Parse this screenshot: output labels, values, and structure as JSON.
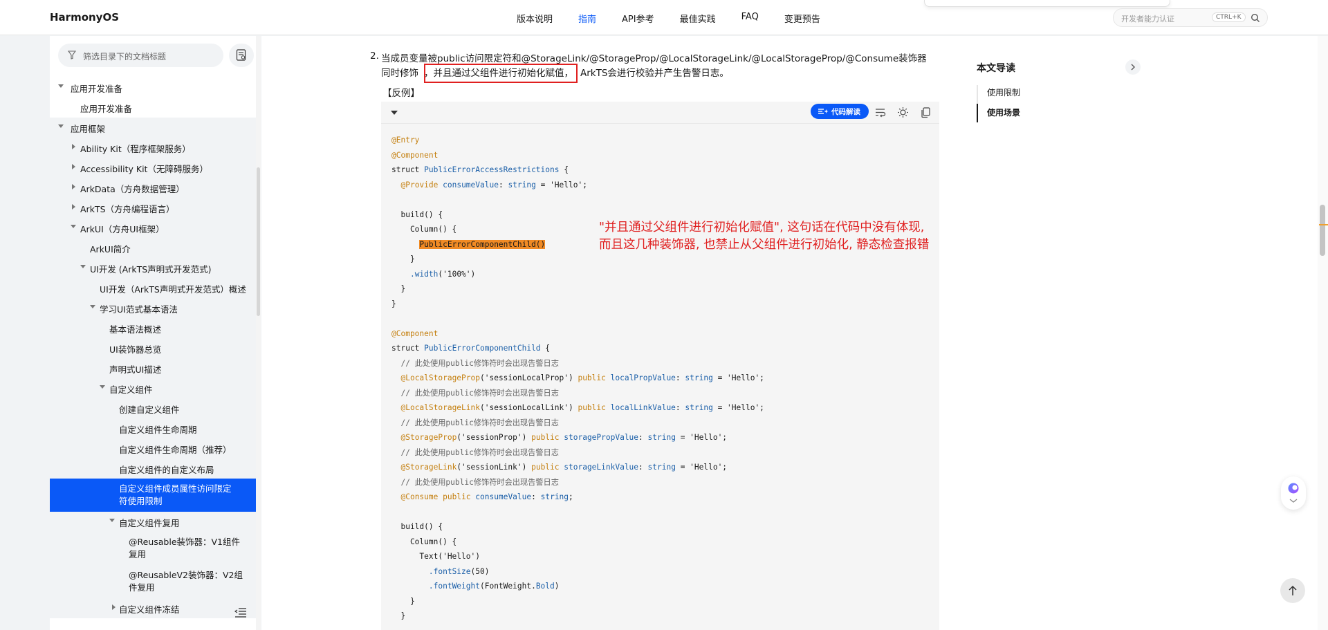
{
  "header": {
    "logo": "HarmonyOS",
    "nav": [
      "版本说明",
      "指南",
      "API参考",
      "最佳实践",
      "FAQ",
      "变更预告"
    ],
    "search_placeholder": "开发者能力认证",
    "search_shortcut": "CTRL+K"
  },
  "sidebar": {
    "filter_placeholder": "筛选目录下的文档标题",
    "items": [
      {
        "label": "应用开发准备",
        "arrow": "down"
      },
      {
        "label": "应用开发准备",
        "arrow": ""
      },
      {
        "label": "应用框架",
        "arrow": "down"
      },
      {
        "label": "Ability Kit（程序框架服务）",
        "arrow": "right"
      },
      {
        "label": "Accessibility Kit（无障碍服务）",
        "arrow": "right"
      },
      {
        "label": "ArkData（方舟数据管理）",
        "arrow": "right"
      },
      {
        "label": "ArkTS（方舟编程语言）",
        "arrow": "right"
      },
      {
        "label": "ArkUI（方舟UI框架）",
        "arrow": "down"
      },
      {
        "label": "ArkUI简介",
        "arrow": ""
      },
      {
        "label": "UI开发 (ArkTS声明式开发范式)",
        "arrow": "down"
      },
      {
        "label": "UI开发（ArkTS声明式开发范式）概述",
        "arrow": ""
      },
      {
        "label": "学习UI范式基本语法",
        "arrow": "down"
      },
      {
        "label": "基本语法概述",
        "arrow": ""
      },
      {
        "label": "UI装饰器总览",
        "arrow": ""
      },
      {
        "label": "声明式UI描述",
        "arrow": ""
      },
      {
        "label": "自定义组件",
        "arrow": "down"
      },
      {
        "label": "创建自定义组件",
        "arrow": ""
      },
      {
        "label": "自定义组件生命周期",
        "arrow": ""
      },
      {
        "label": "自定义组件生命周期（推荐）",
        "arrow": ""
      },
      {
        "label": "自定义组件的自定义布局",
        "arrow": ""
      },
      {
        "label": "自定义组件成员属性访问限定符使用限制",
        "arrow": ""
      },
      {
        "label": "自定义组件复用",
        "arrow": "down"
      },
      {
        "label": "@Reusable装饰器：V1组件复用",
        "arrow": ""
      },
      {
        "label": "@ReusableV2装饰器：V2组件复用",
        "arrow": ""
      },
      {
        "label": "自定义组件冻结",
        "arrow": "right"
      }
    ]
  },
  "content": {
    "list_number": "2.",
    "para_line1": "当成员变量被public访问限定符和@StorageLink/@StorageProp/@LocalStorageLink/@LocalStorageProp/@Consume装饰器",
    "para_line2_prefix": "同时修饰",
    "para_line2_highlight": "，并且通过父组件进行初始化赋值，",
    "para_line2_suffix": "ArkTS会进行校验并产生告警日志。",
    "counter_example": "【反例】",
    "ai_button_label": "代码解读",
    "annotation_line1": "\"并且通过父组件进行初始化赋值\", 这句话在代码中没有体现,",
    "annotation_line2": "而且这几种装饰器, 也禁止从父组件进行初始化, 静态检查报错"
  },
  "code": {
    "l01": "@Entry",
    "l02": "@Component",
    "l03a": "struct ",
    "l03b": "PublicErrorAccessRestrictions",
    "l03c": " {",
    "l04a": "  ",
    "l04b": "@Provide",
    "l04c": " ",
    "l04d": "consumeValue",
    "l04e": ": ",
    "l04f": "string",
    "l04g": " = 'Hello';",
    "l06": "  build() {",
    "l07": "    Column() {",
    "l08a": "      ",
    "l08b": "PublicErrorComponentChild()",
    "l09": "    }",
    "l10a": "    ",
    "l10b": ".width",
    "l10c": "('100%')",
    "l11": "  }",
    "l12": "}",
    "l14": "@Component",
    "l15a": "struct ",
    "l15b": "PublicErrorComponentChild",
    "l15c": " {",
    "c1": "  // 此处使用public修饰符时会出现告警日志",
    "d1a": "  ",
    "d1b": "@LocalStorageProp",
    "d1c": "('sessionLocalProp') ",
    "d1d": "public",
    "d1e": " ",
    "d1f": "localPropValue",
    "d1g": ": ",
    "d1h": "string",
    "d1i": " = 'Hello';",
    "c2": "  // 此处使用public修饰符时会出现告警日志",
    "d2a": "  ",
    "d2b": "@LocalStorageLink",
    "d2c": "('sessionLocalLink') ",
    "d2d": "public",
    "d2e": " ",
    "d2f": "localLinkValue",
    "d2g": ": ",
    "d2h": "string",
    "d2i": " = 'Hello';",
    "c3": "  // 此处使用public修饰符时会出现告警日志",
    "d3a": "  ",
    "d3b": "@StorageProp",
    "d3c": "('sessionProp') ",
    "d3d": "public",
    "d3e": " ",
    "d3f": "storagePropValue",
    "d3g": ": ",
    "d3h": "string",
    "d3i": " = 'Hello';",
    "c4": "  // 此处使用public修饰符时会出现告警日志",
    "d4a": "  ",
    "d4b": "@StorageLink",
    "d4c": "('sessionLink') ",
    "d4d": "public",
    "d4e": " ",
    "d4f": "storageLinkValue",
    "d4g": ": ",
    "d4h": "string",
    "d4i": " = 'Hello';",
    "c5": "  // 此处使用public修饰符时会出现告警日志",
    "d5a": "  ",
    "d5b": "@Consume",
    "d5c": " ",
    "d5d": "public",
    "d5e": " ",
    "d5f": "consumeValue",
    "d5g": ": ",
    "d5h": "string",
    "d5i": ";",
    "b1": "  build() {",
    "b2": "    Column() {",
    "b3": "      Text('Hello')",
    "b4a": "        ",
    "b4b": ".fontSize",
    "b4c": "(50)",
    "b5a": "        ",
    "b5b": ".fontWeight",
    "b5c": "(FontWeight.",
    "b5d": "Bold",
    "b5e": ")",
    "b6": "    }",
    "b7": "  }"
  },
  "toc": {
    "title": "本文导读",
    "items": [
      "使用限制",
      "使用场景"
    ]
  },
  "colors": {
    "accent": "#0a59f7",
    "annotation_red": "#e02020",
    "decorator_orange": "#c47f0e",
    "highlight_orange": "#f08a24"
  }
}
